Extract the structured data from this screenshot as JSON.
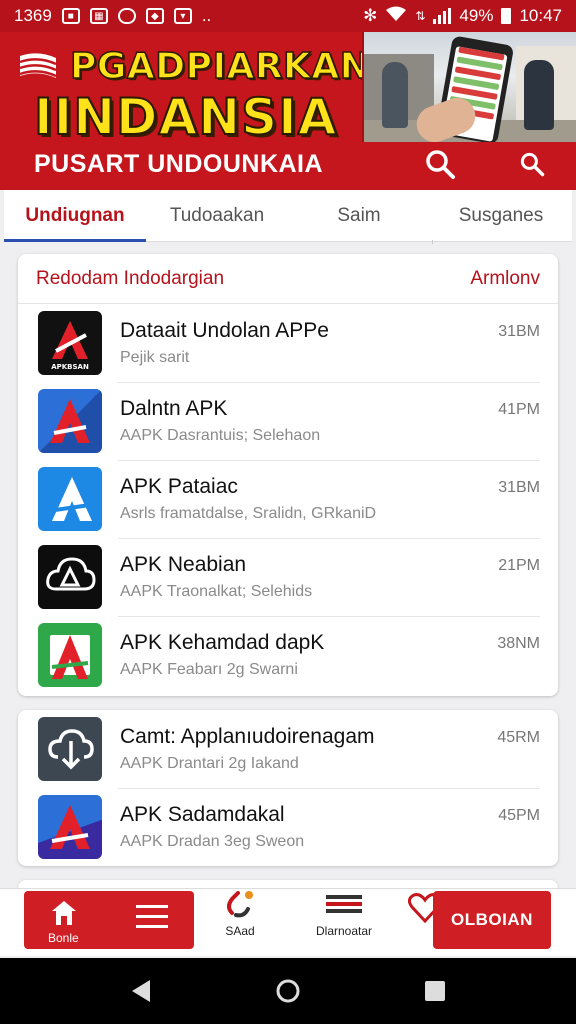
{
  "status_bar": {
    "left_text": "1369",
    "dots": "..",
    "battery": "49%",
    "time": "10:47"
  },
  "header": {
    "title_line1": "PGADPIARKAN",
    "title_line2": "IINDANSIA",
    "subtitle": "PUSART UNDOUNKAIA"
  },
  "tabs": [
    {
      "label": "Undiugnan",
      "active": true
    },
    {
      "label": "Tudoaakan",
      "active": false
    },
    {
      "label": "Saim",
      "active": false
    },
    {
      "label": "Susganes",
      "active": false
    }
  ],
  "section1": {
    "title": "Redodam Indodargian",
    "link": "Armlonv",
    "items": [
      {
        "name": "Dataait Undolan APPe",
        "desc": "Pejik sarit",
        "size": "31BM",
        "icon": "red-a-black-icon"
      },
      {
        "name": "Dalntn APK",
        "desc": "AAPK Dasrantuis; Selehaon",
        "size": "41PM",
        "icon": "red-a-blue-icon"
      },
      {
        "name": "APK Pataiac",
        "desc": "Asrls framatdalse, Sralidn, GRkaniD",
        "size": "31BM",
        "icon": "blue-a-icon"
      },
      {
        "name": "APK Neabian",
        "desc": "AAPK Traonalkat; Selehids",
        "size": "21PM",
        "icon": "cloud-a-icon"
      },
      {
        "name": "APK Kehamdad dapK",
        "desc": "AAPK Feabarı 2g Swarni",
        "size": "38NM",
        "icon": "green-a-icon"
      }
    ]
  },
  "section2": {
    "items": [
      {
        "name": "Camt: Applanıudoirenagam",
        "desc": "AAPK Drantari 2g Iakand",
        "size": "45RM",
        "icon": "slate-cloud-icon"
      },
      {
        "name": "APK Sadamdakal",
        "desc": "AAPK Dradan 3eg Sweon",
        "size": "45PM",
        "icon": "red-a-blue-icon"
      }
    ]
  },
  "bottom_nav": {
    "home": "Bonle",
    "saad": "SAad",
    "dianoatar": "Dlarnoatar",
    "cta": "OLBOIAN"
  },
  "colors": {
    "brand_red": "#c4161c",
    "title_yellow": "#ffe21a",
    "tab_underline": "#2a4fb0"
  }
}
